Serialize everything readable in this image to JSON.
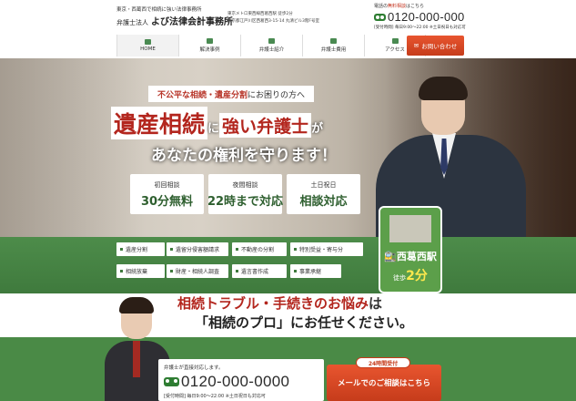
{
  "header": {
    "tagline": "東京・西葛西で相続に強い法律事務所",
    "firm_prefix": "弁護士法人",
    "firm_name": "よび法律会計事務所",
    "address1": "東京メトロ東西線西葛西駅 徒歩2分",
    "address2": "東京都江戸川区西葛西3-15-14 丸清ビル3階F号室",
    "phone_note_pre": "電話の",
    "phone_note_red": "無料相談",
    "phone_note_post": "はこちら",
    "phone": "0120-000-000",
    "phone_hours": "[受付時間] 毎日9:00〜22:00 ※土日祝日も対応可"
  },
  "nav": {
    "items": [
      {
        "label": "HOME"
      },
      {
        "label": "解決事例"
      },
      {
        "label": "弁護士紹介"
      },
      {
        "label": "弁護士費用"
      },
      {
        "label": "アクセス"
      }
    ],
    "contact_label": "お問い合わせ"
  },
  "hero": {
    "sub_highlight": "不公平な相続・遺産分割",
    "sub_rest": "にお困りの方へ",
    "title_big": "遺産相続",
    "title_mid1": "に",
    "title_red": "強い弁護士",
    "title_mid2": "が",
    "title_line2": "あなたの権利を守ります！",
    "features": [
      {
        "top": "初回相談",
        "bottom": "30分無料"
      },
      {
        "top": "夜間相談",
        "bottom": "22時まで対応"
      },
      {
        "top": "土日祝日",
        "bottom": "相談対応"
      }
    ]
  },
  "categories": [
    "遺産分割",
    "遺留分侵害額請求",
    "不動産の分割",
    "特別受益・寄与分",
    "相続放棄",
    "財産・相続人調査",
    "遺言書作成",
    "事業承継"
  ],
  "station": {
    "name": "西葛西駅",
    "walk_prefix": "徒歩",
    "walk_min": "2分"
  },
  "lower": {
    "worry_red": "相続トラブル・手続きのお悩み",
    "worry_rest": "は",
    "worry_line2": "「相続のプロ」にお任せください。",
    "cta_note": "弁護士が直接対応します。",
    "cta_phone": "0120-000-0000",
    "cta_hours": "[受付時間] 毎日9:00〜22:00 ※土日祝日も対応可",
    "badge": "24時間受付",
    "mail_label": "メールでのご相談はこちら"
  },
  "colors": {
    "brand_green": "#3f7a3d",
    "accent_red": "#c63c1b"
  }
}
